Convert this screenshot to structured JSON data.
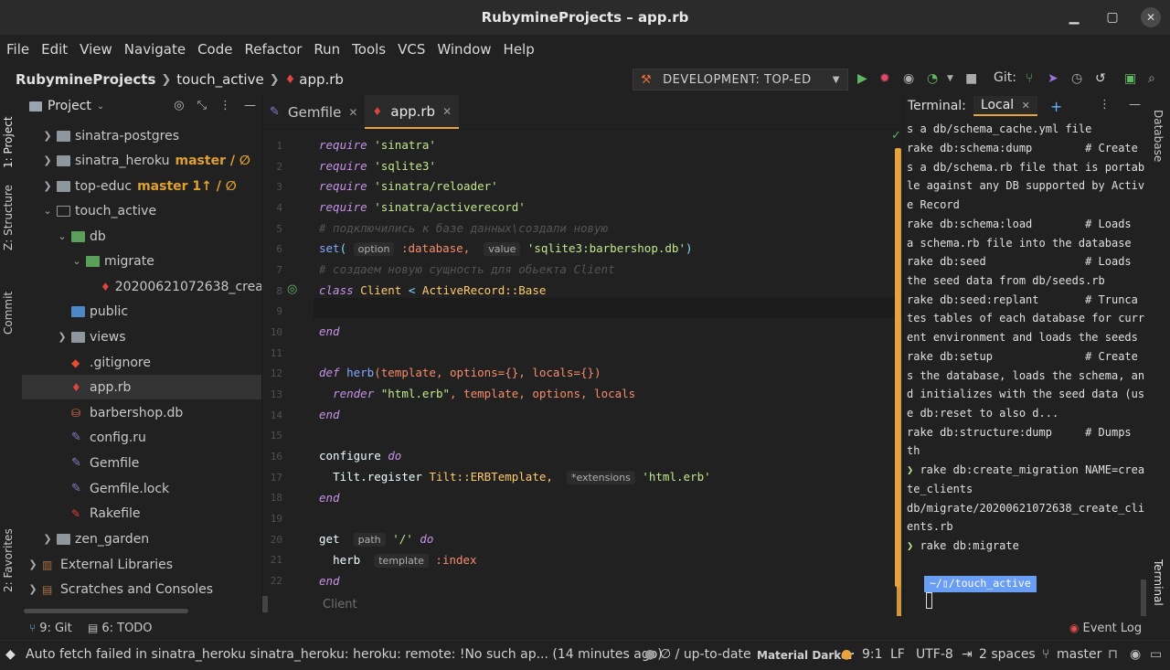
{
  "window": {
    "title": "RubymineProjects – app.rb",
    "minimize": "▁",
    "maximize": "▢",
    "close": "✕"
  },
  "menu": [
    "File",
    "Edit",
    "View",
    "Navigate",
    "Code",
    "Refactor",
    "Run",
    "Tools",
    "VCS",
    "Window",
    "Help"
  ],
  "breadcrumb": {
    "project": "RubymineProjects",
    "folder": "touch_active",
    "file": "app.rb"
  },
  "run_config": {
    "label": "DEVELOPMENT: TOP-ED",
    "git_label": "Git:"
  },
  "left_tabs": {
    "project": "1: Project",
    "structure": "Z: Structure",
    "commit": "Commit",
    "favorites": "2: Favorites"
  },
  "project_panel": {
    "title": "Project",
    "items": [
      {
        "label": "sinatra-postgres",
        "branch": ""
      },
      {
        "label": "sinatra_heroku",
        "branch": "master / ∅"
      },
      {
        "label": "top-educ",
        "branch": "master 1↑ / ∅"
      },
      {
        "label": "touch_active",
        "branch": ""
      },
      {
        "label": "db",
        "branch": ""
      },
      {
        "label": "migrate",
        "branch": ""
      },
      {
        "label": "20200621072638_create_clients.rb",
        "branch": ""
      },
      {
        "label": "public",
        "branch": ""
      },
      {
        "label": "views",
        "branch": ""
      },
      {
        "label": ".gitignore",
        "branch": ""
      },
      {
        "label": "app.rb",
        "branch": ""
      },
      {
        "label": "barbershop.db",
        "branch": ""
      },
      {
        "label": "config.ru",
        "branch": ""
      },
      {
        "label": "Gemfile",
        "branch": ""
      },
      {
        "label": "Gemfile.lock",
        "branch": ""
      },
      {
        "label": "Rakefile",
        "branch": ""
      },
      {
        "label": "zen_garden",
        "branch": ""
      },
      {
        "label": "External Libraries",
        "branch": ""
      },
      {
        "label": "Scratches and Consoles",
        "branch": ""
      }
    ]
  },
  "editor": {
    "tabs": [
      {
        "label": "Gemfile"
      },
      {
        "label": "app.rb"
      }
    ],
    "line_numbers": [
      "1",
      "2",
      "3",
      "4",
      "5",
      "6",
      "7",
      "8",
      "9",
      "10",
      "11",
      "12",
      "13",
      "14",
      "15",
      "16",
      "17",
      "18",
      "19",
      "20",
      "21",
      "22"
    ],
    "code": {
      "l1_kw": "require",
      "l1_str": "'sinatra'",
      "l2_kw": "require",
      "l2_str": "'sqlite3'",
      "l3_kw": "require",
      "l3_str": "'sinatra/reloader'",
      "l4_kw": "require",
      "l4_str": "'sinatra/activerecord'",
      "l5_cmt": "# подключились к базе данных\\создали новую",
      "l6_fn": "set",
      "l6_hint1": "option",
      "l6_sym": ":database,",
      "l6_hint2": "value",
      "l6_str": "'sqlite3:barbershop.db'",
      "l7_cmt": "# создаем новую сущность для обьекта Client",
      "l8_kw": "class",
      "l8_cls": "Client",
      "l8_op": "<",
      "l8_cls2": "ActiveRecord::Base",
      "l10_kw": "end",
      "l12_kw": "def",
      "l12_fn": "herb",
      "l12_args": "(template, options={}, locals={})",
      "l13_fn": "render",
      "l13_str": "\"html.erb\"",
      "l13_rest": ", template, options, locals",
      "l14_kw": "end",
      "l16_plain": "configure",
      "l16_kw": "do",
      "l17_plain": "Tilt.register",
      "l17_cls": "Tilt::ERBTemplate,",
      "l17_hint": "*extensions",
      "l17_str": "'html.erb'",
      "l18_kw": "end",
      "l20_plain": "get",
      "l20_hint": "path",
      "l20_str": "'/'",
      "l20_kw": "do",
      "l21_plain": "herb",
      "l21_hint": "template",
      "l21_sym": ":index",
      "l22_kw": "end"
    },
    "footer_crumb": "Client"
  },
  "terminal": {
    "label": "Terminal:",
    "tab": "Local",
    "lines": [
      "s a db/schema_cache.yml file",
      "rake db:schema:dump        # Create",
      "s a db/schema.rb file that is portab",
      "le against any DB supported by Activ",
      "e Record",
      "rake db:schema:load        # Loads",
      "a schema.rb file into the database",
      "rake db:seed               # Loads",
      "the seed data from db/seeds.rb",
      "rake db:seed:replant       # Trunca",
      "tes tables of each database for curr",
      "ent environment and loads the seeds",
      "rake db:setup              # Create",
      "s the database, loads the schema, an",
      "d initializes with the seed data (us",
      "e db:reset to also d...",
      "rake db:structure:dump     # Dumps",
      "th"
    ],
    "cmd1_prompt": "❯",
    "cmd1": " rake db:create_migration NAME=crea",
    "cmd1_cont": "te_clients",
    "out1": "db/migrate/20200621072638_create_cli",
    "out1_cont": "ents.rb",
    "cmd2_prompt": "❯",
    "cmd2": " rake db:migrate",
    "prompt_path": "~/▯/touch_active"
  },
  "right_tabs": {
    "database": "Database",
    "terminal": "Terminal"
  },
  "bottom_tools": {
    "git": "9: Git",
    "todo": "6: TODO",
    "event_log": "Event Log"
  },
  "status": {
    "message": "Auto fetch failed in sinatra_heroku sinatra_heroku: heroku: remote: !No such ap... (14 minutes ago)",
    "vcs": "∅ / up-to-date",
    "theme": "Material Darker",
    "position": "9:1",
    "line_sep": "LF",
    "encoding": "UTF-8",
    "indent": "2 spaces",
    "branch": "master"
  },
  "colors": {
    "accent": "#e8a33d",
    "background": "#212121",
    "keyword": "#c792ea",
    "string": "#c3e88d"
  }
}
